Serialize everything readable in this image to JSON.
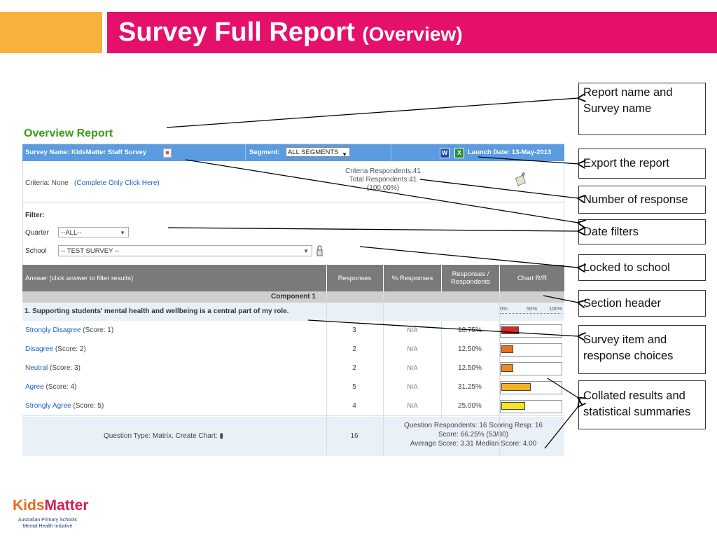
{
  "slide": {
    "title": "Survey Full Report",
    "title_sub": "(Overview)",
    "colors": {
      "accent": "#E4106A",
      "orange": "#F7B13D"
    }
  },
  "report": {
    "title": "Overview Report",
    "survey_name": "Survey Name: KidsMatter Staff Survey",
    "segment_label": "Segment:",
    "segment_value": "ALL SEGMENTS",
    "launch_date": "Launch Date: 13-May-2013",
    "criteria_label": "Criteria: None",
    "criteria_link": "(Complete Only Click Here)",
    "criteria_respondents": "Criteria Respondents:41",
    "total_respondents": "Total Respondents:41",
    "total_pct": "(100.00%)",
    "filter_label": "Filter:",
    "quarter_label": "Quarter",
    "quarter_value": "--ALL--",
    "school_label": "School",
    "school_value": "-- TEST SURVEY --",
    "columns": {
      "answer": "Answer (click answer to filter results)",
      "responses": "Responses",
      "pct_responses": "% Responses",
      "resp_per_resp": "Responses / Respondents",
      "chart": "Chart R/R"
    },
    "component": "Component 1",
    "question": "1. Supporting students' mental health and wellbeing is a central part of my role.",
    "scale": [
      "0%",
      "50%",
      "100%"
    ],
    "answers": [
      {
        "label": "Strongly Disagree",
        "score": "(Score: 1)",
        "responses": "3",
        "na": "N/A",
        "pct": "18.75%",
        "fill": 0.1875,
        "color": "#d62a1e"
      },
      {
        "label": "Disagree",
        "score": "(Score: 2)",
        "responses": "2",
        "na": "N/A",
        "pct": "12.50%",
        "fill": 0.125,
        "color": "#e8701e"
      },
      {
        "label": "Neutral",
        "score": "(Score: 3)",
        "responses": "2",
        "na": "N/A",
        "pct": "12.50%",
        "fill": 0.125,
        "color": "#ef8a1f"
      },
      {
        "label": "Agree",
        "score": "(Score: 4)",
        "responses": "5",
        "na": "N/A",
        "pct": "31.25%",
        "fill": 0.3125,
        "color": "#f3b21f"
      },
      {
        "label": "Strongly Agree",
        "score": "(Score: 5)",
        "responses": "4",
        "na": "N/A",
        "pct": "25.00%",
        "fill": 0.25,
        "color": "#f4e61e"
      }
    ],
    "summary": {
      "question_type": "Question Type: Matrix. Create Chart:",
      "total": "16",
      "line1": "Question Respondents: 16   Scoring Resp: 16",
      "line2": "Score: 66.25% (53/80)",
      "line3": "Average Score: 3.31    Median Score: 4.00"
    }
  },
  "callouts": [
    "Report name and Survey name",
    "Export the report",
    "Number of response",
    "Date filters",
    "Locked to school",
    "Section header",
    "Survey item and response choices",
    "Collated results and statistical summaries"
  ],
  "logo": {
    "kids": "Kids",
    "matter": "Matter",
    "line1": "Australian Primary Schools",
    "line2": "Mental Health Initiative"
  }
}
